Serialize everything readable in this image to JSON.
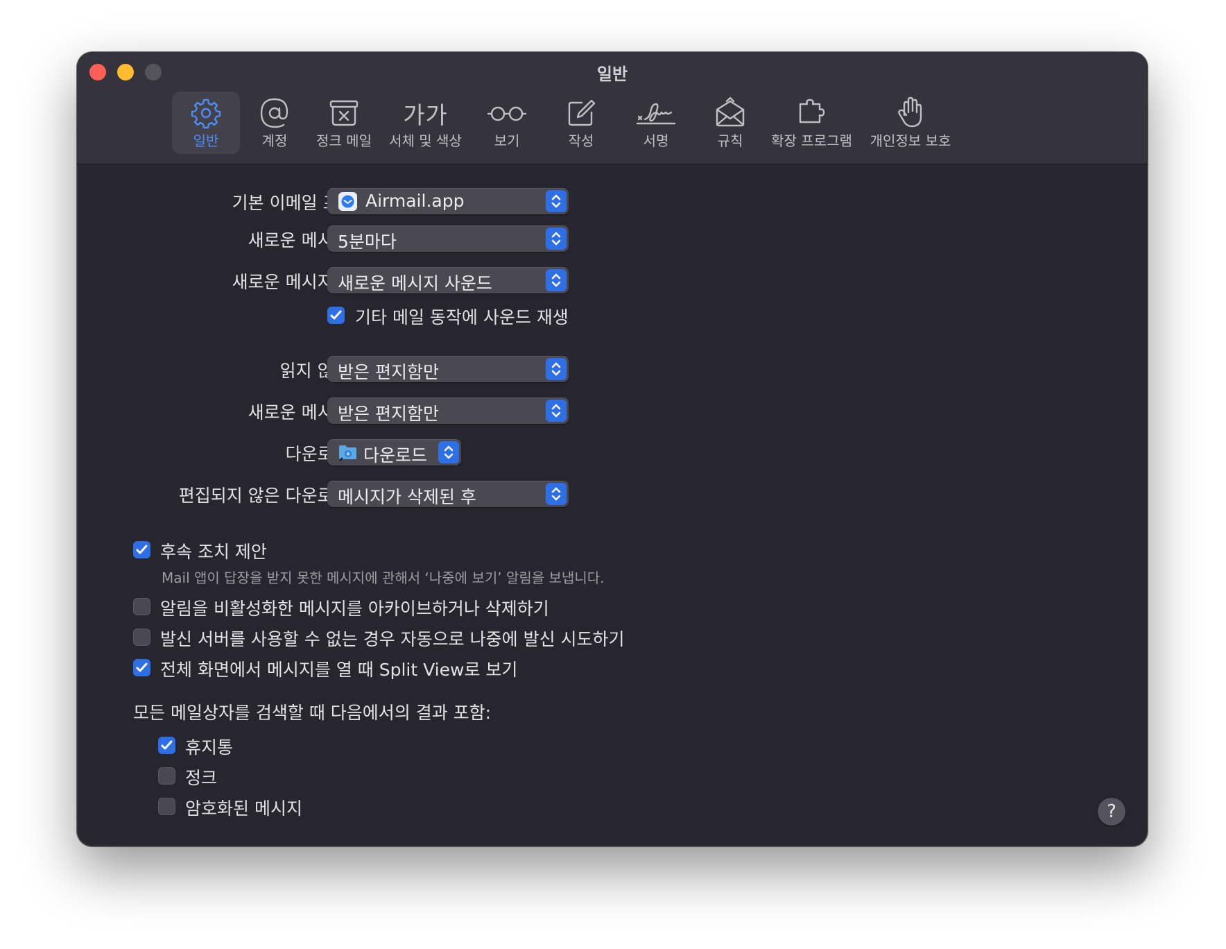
{
  "window": {
    "title": "일반"
  },
  "toolbar": {
    "items": [
      {
        "label": "일반",
        "icon": "gear-icon"
      },
      {
        "label": "계정",
        "icon": "at-sign-icon"
      },
      {
        "label": "정크 메일",
        "icon": "junk-tray-icon"
      },
      {
        "label": "서체 및 색상",
        "icon": "font-icon"
      },
      {
        "label": "보기",
        "icon": "glasses-icon"
      },
      {
        "label": "작성",
        "icon": "compose-icon"
      },
      {
        "label": "서명",
        "icon": "signature-icon"
      },
      {
        "label": "규칙",
        "icon": "rules-envelope-icon"
      },
      {
        "label": "확장 프로그램",
        "icon": "puzzle-icon"
      },
      {
        "label": "개인정보 보호",
        "icon": "hand-icon"
      }
    ],
    "font_glyph": "가가",
    "active": "일반"
  },
  "settings": {
    "default_mail": {
      "label": "기본 이메일 프로그램:",
      "value": "Airmail.app",
      "icon": "airmail-app-icon"
    },
    "check_new": {
      "label": "새로운 메시지 확인:",
      "value": "5분마다"
    },
    "sound": {
      "label": "새로운 메시지 사운드:",
      "value": "새로운 메시지 사운드"
    },
    "play_sounds": {
      "label": "기타 메일 동작에 사운드 재생",
      "checked": true
    },
    "unread_count": {
      "label": "읽지 않은 개수:",
      "value": "받은 편지함만"
    },
    "notifications": {
      "label": "새로운 메시지 알림:",
      "value": "받은 편지함만"
    },
    "download_folder": {
      "label": "다운로드 폴더:",
      "value": "다운로드",
      "icon": "folder-icon"
    },
    "remove_downloads": {
      "label": "편집되지 않은 다운로드 제거:",
      "value": "메시지가 삭제된 후"
    }
  },
  "options": {
    "follow_up": {
      "label": "후속 조치 제안",
      "checked": true,
      "hint": "Mail 앱이 답장을 받지 못한 메시지에 관해서 ‘나중에 보기’ 알림을 보냅니다."
    },
    "archive_muted": {
      "label": "알림을 비활성화한 메시지를 아카이브하거나 삭제하기",
      "checked": false
    },
    "retry_send": {
      "label": "발신 서버를 사용할 수 없는 경우 자동으로 나중에 발신 시도하기",
      "checked": false
    },
    "split_view": {
      "label": "전체 화면에서 메시지를 열 때 Split View로 보기",
      "checked": true
    }
  },
  "search": {
    "heading": "모든 메일상자를 검색할 때 다음에서의 결과 포함:",
    "trash": {
      "label": "휴지통",
      "checked": true
    },
    "junk": {
      "label": "정크",
      "checked": false
    },
    "encrypted": {
      "label": "암호화된 메시지",
      "checked": false
    }
  },
  "help": {
    "label": "?"
  },
  "colors": {
    "accent": "#2f6fe6",
    "toolbar_active": "#4f8df6",
    "window_bg": "#27252d",
    "titlebar_bg": "#35333b"
  }
}
